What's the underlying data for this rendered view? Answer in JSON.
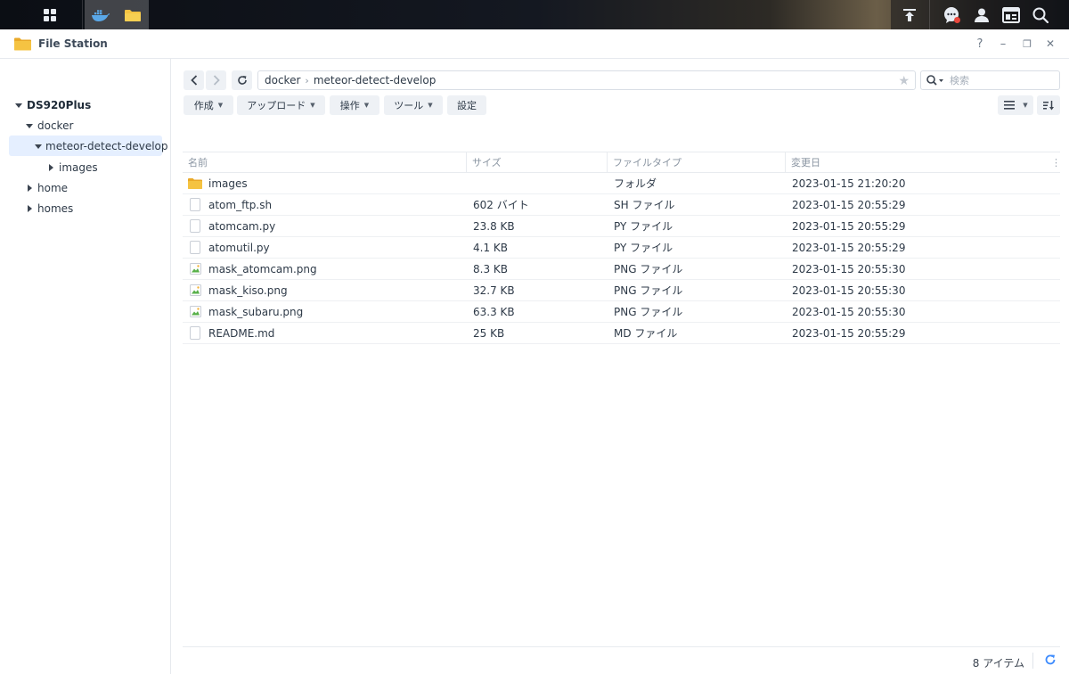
{
  "taskbar": {
    "main_menu_icon": "grid-icon",
    "apps": [
      "docker-icon",
      "file-station-icon"
    ],
    "right_icons": [
      "upload-icon",
      "chat-icon",
      "user-icon",
      "widgets-icon",
      "search-icon"
    ]
  },
  "window": {
    "title": "File Station",
    "controls": {
      "help": "?",
      "minimize": "–",
      "restore": "❐",
      "close": "✕"
    }
  },
  "sidebar": {
    "items": [
      {
        "label": "DS920Plus",
        "level": 0,
        "expanded": true,
        "root": true
      },
      {
        "label": "docker",
        "level": 1,
        "expanded": true
      },
      {
        "label": "meteor-detect-develop",
        "level": 2,
        "expanded": true,
        "selected": true
      },
      {
        "label": "images",
        "level": 3,
        "expanded": false
      },
      {
        "label": "home",
        "level": 1,
        "expanded": false
      },
      {
        "label": "homes",
        "level": 1,
        "expanded": false
      }
    ]
  },
  "path": {
    "segments": [
      "docker",
      "meteor-detect-develop"
    ],
    "separator": "›"
  },
  "search": {
    "placeholder": "検索"
  },
  "toolbar": {
    "create": "作成",
    "upload": "アップロード",
    "action": "操作",
    "tools": "ツール",
    "settings": "設定"
  },
  "table": {
    "headers": {
      "name": "名前",
      "size": "サイズ",
      "type": "ファイルタイプ",
      "modified": "変更日"
    },
    "rows": [
      {
        "kind": "folder",
        "name": "images",
        "size": "",
        "type": "フォルダ",
        "modified": "2023-01-15 21:20:20"
      },
      {
        "kind": "file",
        "name": "atom_ftp.sh",
        "size": "602 バイト",
        "type": "SH ファイル",
        "modified": "2023-01-15 20:55:29"
      },
      {
        "kind": "file",
        "name": "atomcam.py",
        "size": "23.8 KB",
        "type": "PY ファイル",
        "modified": "2023-01-15 20:55:29"
      },
      {
        "kind": "file",
        "name": "atomutil.py",
        "size": "4.1 KB",
        "type": "PY ファイル",
        "modified": "2023-01-15 20:55:29"
      },
      {
        "kind": "image",
        "name": "mask_atomcam.png",
        "size": "8.3 KB",
        "type": "PNG ファイル",
        "modified": "2023-01-15 20:55:30"
      },
      {
        "kind": "image",
        "name": "mask_kiso.png",
        "size": "32.7 KB",
        "type": "PNG ファイル",
        "modified": "2023-01-15 20:55:30"
      },
      {
        "kind": "image",
        "name": "mask_subaru.png",
        "size": "63.3 KB",
        "type": "PNG ファイル",
        "modified": "2023-01-15 20:55:30"
      },
      {
        "kind": "file",
        "name": "README.md",
        "size": "25 KB",
        "type": "MD ファイル",
        "modified": "2023-01-15 20:55:29"
      }
    ]
  },
  "footer": {
    "item_count": "8 アイテム"
  },
  "colors": {
    "accent": "#3d8bfd",
    "folder": "#f5c342",
    "selected_bg": "#e5efff",
    "notification": "#e8473d"
  }
}
